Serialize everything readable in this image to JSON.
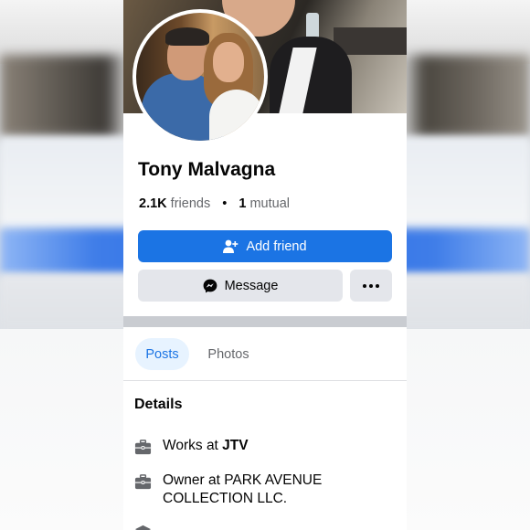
{
  "profile": {
    "name": "Tony Malvagna",
    "friends_count": "2.1K",
    "friends_label": "friends",
    "separator": "•",
    "mutual_count": "1",
    "mutual_label": "mutual"
  },
  "actions": {
    "add_friend_label": "Add friend",
    "message_label": "Message"
  },
  "tabs": [
    {
      "label": "Posts",
      "active": true
    },
    {
      "label": "Photos",
      "active": false
    }
  ],
  "details": {
    "title": "Details",
    "items": [
      {
        "icon": "briefcase-icon",
        "prefix": "Works at ",
        "strong": "JTV"
      },
      {
        "icon": "briefcase-icon",
        "prefix": "Owner at PARK AVENUE COLLECTION LLC.",
        "strong": ""
      },
      {
        "icon": "graduation-cap-icon",
        "prefix": "",
        "strong": ""
      }
    ]
  },
  "colors": {
    "accent": "#1b74e4",
    "secondary_button": "#e4e6eb",
    "tab_active_bg": "#e7f3ff"
  }
}
